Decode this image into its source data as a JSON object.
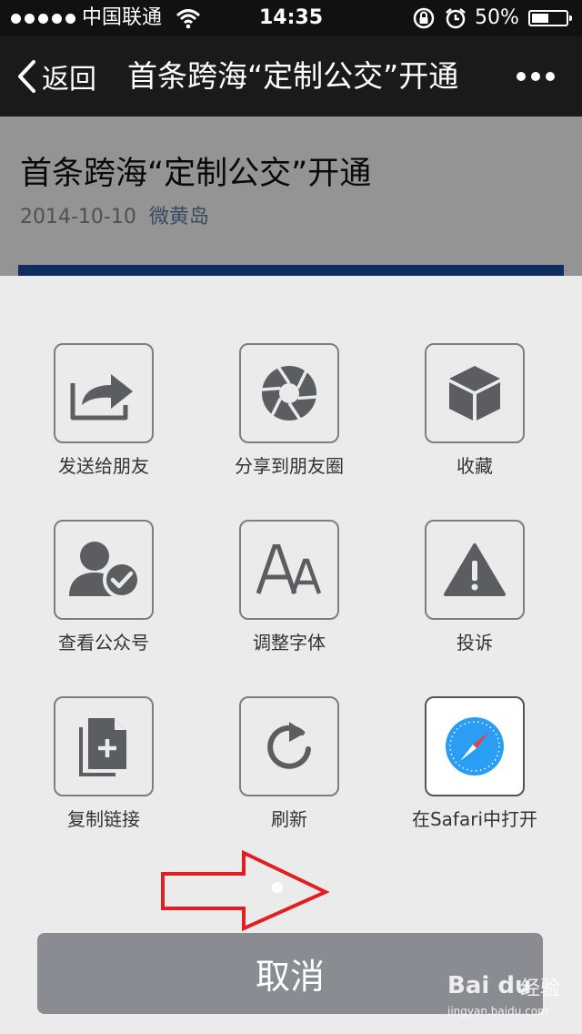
{
  "status_bar": {
    "carrier": "中国联通",
    "time": "14:35",
    "battery": "50%",
    "battery_level": 0.5
  },
  "nav": {
    "back_label": "返回",
    "title": "首条跨海“定制公交”开通"
  },
  "article": {
    "title": "首条跨海“定制公交”开通",
    "date": "2014-10-10",
    "author": "微黄岛"
  },
  "share_menu": {
    "items": [
      {
        "label": "发送给朋友",
        "icon": "send-to-friend-icon"
      },
      {
        "label": "分享到朋友圈",
        "icon": "moments-shutter-icon"
      },
      {
        "label": "收藏",
        "icon": "favorite-cube-icon"
      },
      {
        "label": "查看公众号",
        "icon": "official-account-icon"
      },
      {
        "label": "调整字体",
        "icon": "font-size-icon"
      },
      {
        "label": "投诉",
        "icon": "warning-icon"
      },
      {
        "label": "复制链接",
        "icon": "copy-link-icon"
      },
      {
        "label": "刷新",
        "icon": "refresh-icon"
      },
      {
        "label": "在Safari中打开",
        "icon": "safari-compass-icon"
      }
    ],
    "cancel_label": "取消"
  },
  "watermark": {
    "logo": "Bai du",
    "text": "经验",
    "url": "jingyan.baidu.com"
  },
  "colors": {
    "annotation_arrow": "#e02020",
    "cancel_bg": "#8a8c91",
    "link": "#607fa6"
  }
}
